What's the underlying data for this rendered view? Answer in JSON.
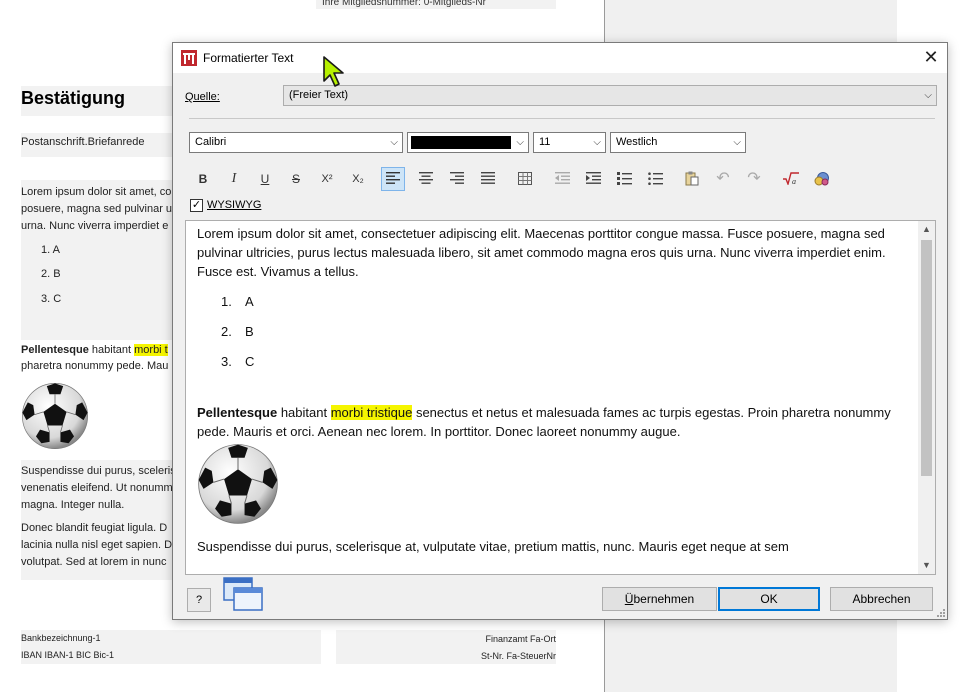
{
  "doc": {
    "top_line": "Ihre Mitgliedsnummer: 0-Mitglieds-Nr",
    "title": "Bestätigung",
    "salutation": "Postanschrift.Briefanrede",
    "para1": [
      "Lorem ipsum dolor sit amet, co",
      "posuere, magna sed pulvinar u",
      "urna. Nunc viverra imperdiet e"
    ],
    "list": [
      "1.   A",
      "2.   B",
      "3.   C"
    ],
    "para2_bold": "Pellentesque",
    "para2_mid": " habitant ",
    "para2_hl": "morbi t",
    "para2_line2": "pharetra nonummy pede. Mau",
    "para3": [
      "Suspendisse dui purus, sceleris",
      "venenatis eleifend. Ut nonumm",
      "magna. Integer nulla."
    ],
    "para4": [
      "Donec blandit feugiat ligula. D",
      "lacinia nulla nisl eget sapien. D",
      "volutpat. Sed at lorem in nunc"
    ],
    "footer_left": [
      "Bankbezeichnung-1",
      "IBAN  IBAN-1  BIC  Bic-1"
    ],
    "footer_right": [
      "Finanzamt Fa-Ort",
      "St-Nr. Fa-SteuerNr"
    ]
  },
  "dialog": {
    "title": "Formatierter Text",
    "close_glyph": "✕",
    "source_label": "Quelle:",
    "source_value": "(Freier Text)",
    "font_family": "Calibri",
    "font_color": "#000000",
    "font_size": "11",
    "script": "Westlich",
    "toolbar": {
      "bold": "B",
      "italic": "I",
      "underline": "U",
      "strike": "S",
      "superscript": "X²",
      "subscript": "X₂"
    },
    "wysiwyg_label": "WYSIWYG",
    "wysiwyg_checked": "✓",
    "editor": {
      "para1": "Lorem ipsum dolor sit amet, consectetuer adipiscing elit. Maecenas porttitor congue massa. Fusce posuere, magna sed pulvinar ultricies, purus lectus malesuada libero, sit amet commodo magna eros quis urna. Nunc viverra imperdiet enim. Fusce est. Vivamus a tellus.",
      "list": [
        {
          "num": "1.",
          "text": "A"
        },
        {
          "num": "2.",
          "text": "B"
        },
        {
          "num": "3.",
          "text": "C"
        }
      ],
      "para2_bold": "Pellentesque",
      "para2_mid": " habitant ",
      "para2_hl": "morbi tristique",
      "para2_rest": " senectus et netus et malesuada fames ac turpis egestas. Proin pharetra nonummy pede. Mauris et orci. Aenean nec lorem. In porttitor. Donec laoreet nonummy augue.",
      "para3": "Suspendisse dui purus, scelerisque at, vulputate vitae, pretium mattis, nunc. Mauris eget neque at sem"
    },
    "buttons": {
      "help": "?",
      "apply_u": "Ü",
      "apply_rest": "bernehmen",
      "ok": "OK",
      "cancel": "Abbrechen"
    }
  },
  "colors": {
    "highlight": "#f5f500",
    "accent": "#0078d7",
    "logo_red": "#c0282e"
  }
}
